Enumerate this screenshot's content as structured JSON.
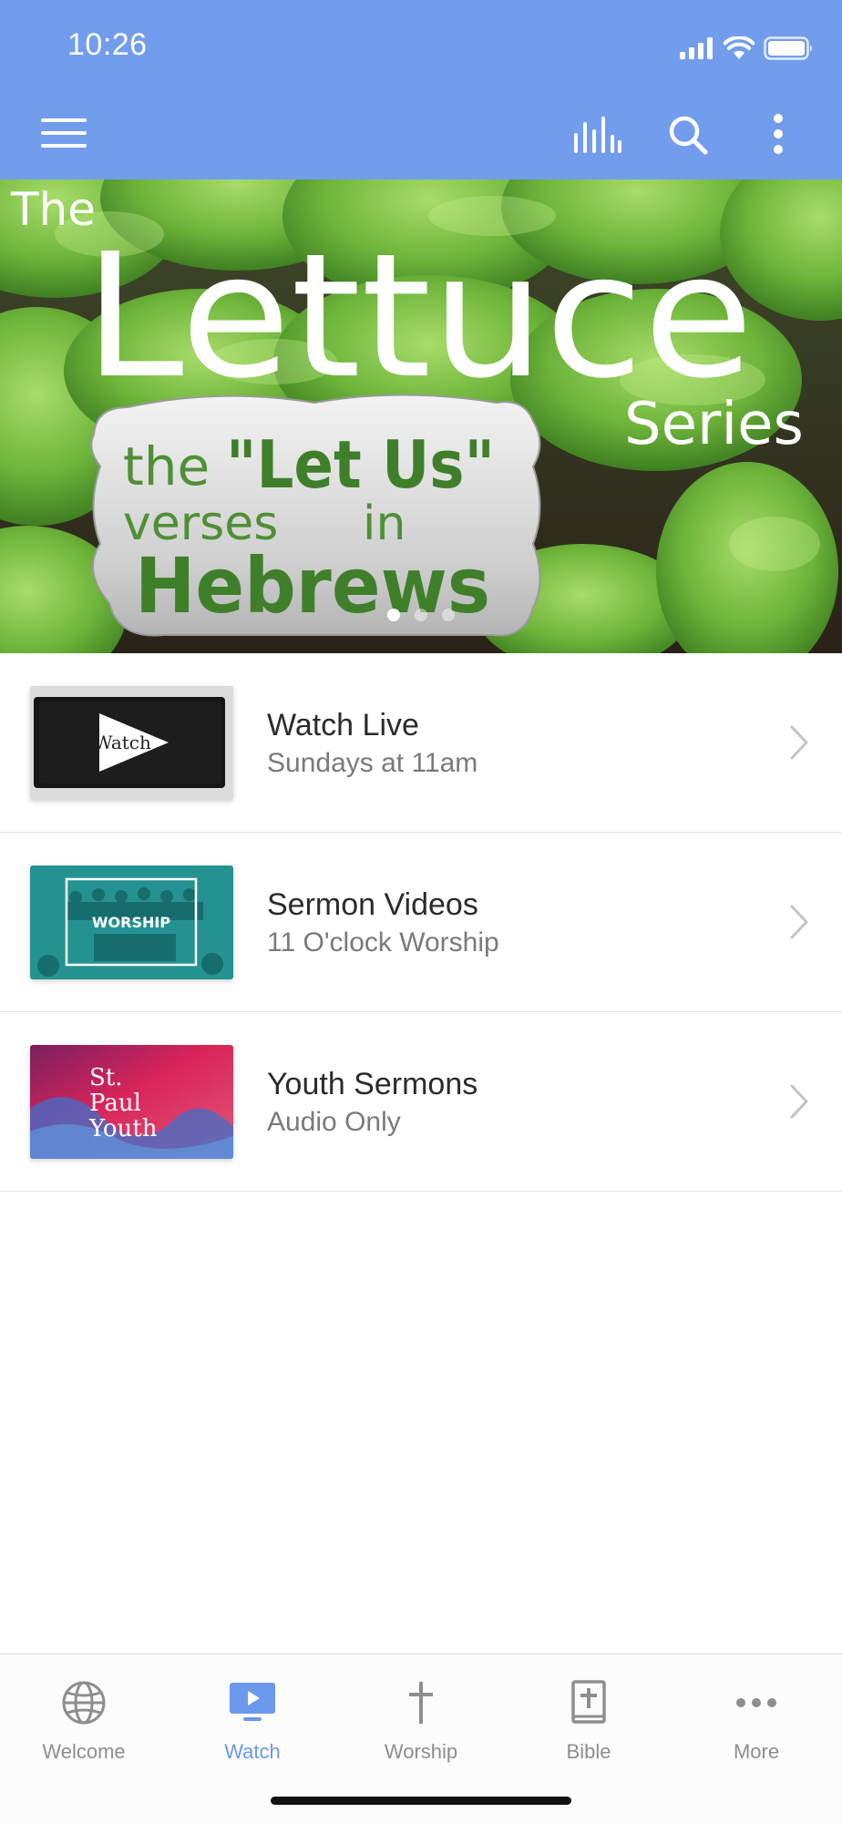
{
  "status_bar": {
    "time": "10:26"
  },
  "colors": {
    "header": "#729ded",
    "accent": "#6b99eb",
    "tab_inactive": "#8e8e8e"
  },
  "toolbar": {
    "icons": [
      "menu-icon",
      "equalizer-icon",
      "search-icon",
      "more-vertical-icon"
    ]
  },
  "hero": {
    "line_the": "The",
    "title": "Lettuce",
    "series": "Series",
    "badge_the": "the",
    "badge_let_us": "\"Let Us\"",
    "badge_verses": "verses",
    "badge_in": "in",
    "badge_hebrews": "Hebrews",
    "page_count": 3,
    "active_page": 1
  },
  "list": {
    "items": [
      {
        "title": "Watch Live",
        "subtitle": "Sundays at 11am",
        "thumb_text": "Watch"
      },
      {
        "title": "Sermon Videos",
        "subtitle": "11 O'clock Worship",
        "thumb_text": "WORSHIP"
      },
      {
        "title": "Youth Sermons",
        "subtitle": "Audio Only",
        "thumb_line1": "St.",
        "thumb_line2": "Paul",
        "thumb_line3": "Youth"
      }
    ]
  },
  "tabs": [
    {
      "label": "Welcome",
      "icon": "globe-icon"
    },
    {
      "label": "Watch",
      "icon": "tv-play-icon",
      "active": true
    },
    {
      "label": "Worship",
      "icon": "cross-icon"
    },
    {
      "label": "Bible",
      "icon": "bible-icon"
    },
    {
      "label": "More",
      "icon": "ellipsis-icon"
    }
  ]
}
